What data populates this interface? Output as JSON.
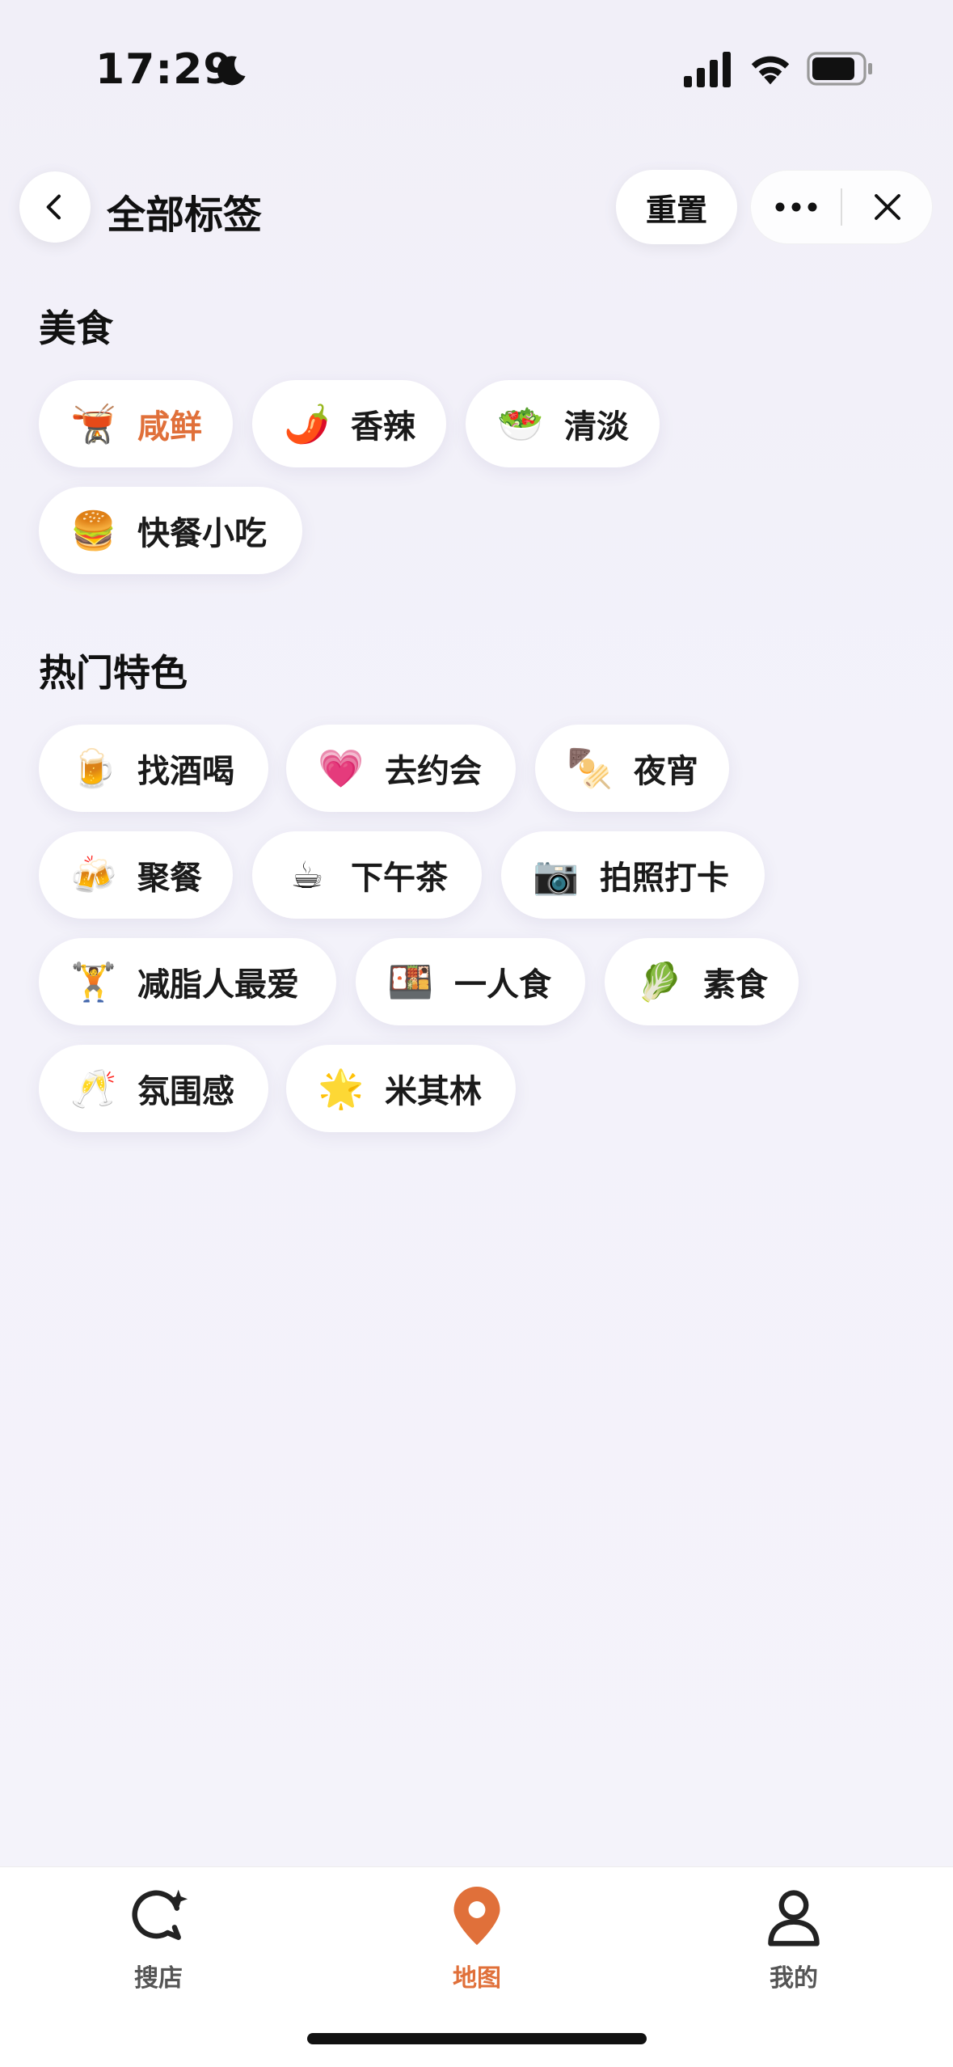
{
  "status": {
    "time": "17:29"
  },
  "header": {
    "title": "全部标签",
    "reset_label": "重置"
  },
  "icons": {
    "back": "chevron-left-icon",
    "more": "more-dots-icon",
    "close": "close-icon",
    "moon": "moon-icon",
    "signal": "signal-icon",
    "wifi": "wifi-icon",
    "battery": "battery-icon"
  },
  "colors": {
    "accent": "#e0703a",
    "chip_bg": "#ffffff",
    "page_bg": "#f3f2fa"
  },
  "sections": [
    {
      "title": "美食",
      "chips": [
        {
          "emoji": "🫕",
          "label": "咸鲜",
          "selected": true
        },
        {
          "emoji": "🌶️",
          "label": "香辣",
          "selected": false
        },
        {
          "emoji": "🥗",
          "label": "清淡",
          "selected": false
        },
        {
          "emoji": "🍔",
          "label": "快餐小吃",
          "selected": false
        }
      ]
    },
    {
      "title": "热门特色",
      "chips": [
        {
          "emoji": "🍺",
          "label": "找酒喝",
          "selected": false
        },
        {
          "emoji": "💗",
          "label": "去约会",
          "selected": false
        },
        {
          "emoji": "🍢",
          "label": "夜宵",
          "selected": false
        },
        {
          "emoji": "🍻",
          "label": "聚餐",
          "selected": false
        },
        {
          "emoji": "☕",
          "label": "下午茶",
          "selected": false
        },
        {
          "emoji": "📷",
          "label": "拍照打卡",
          "selected": false
        },
        {
          "emoji": "🏋️",
          "label": "减脂人最爱",
          "selected": false
        },
        {
          "emoji": "🍱",
          "label": "一人食",
          "selected": false
        },
        {
          "emoji": "🥬",
          "label": "素食",
          "selected": false
        },
        {
          "emoji": "🥂",
          "label": "氛围感",
          "selected": false
        },
        {
          "emoji": "🌟",
          "label": "米其林",
          "selected": false
        }
      ]
    }
  ],
  "tabbar": {
    "tabs": [
      {
        "label": "搜店",
        "icon": "search-store-icon",
        "active": false
      },
      {
        "label": "地图",
        "icon": "map-pin-icon",
        "active": true
      },
      {
        "label": "我的",
        "icon": "profile-icon",
        "active": false
      }
    ]
  }
}
